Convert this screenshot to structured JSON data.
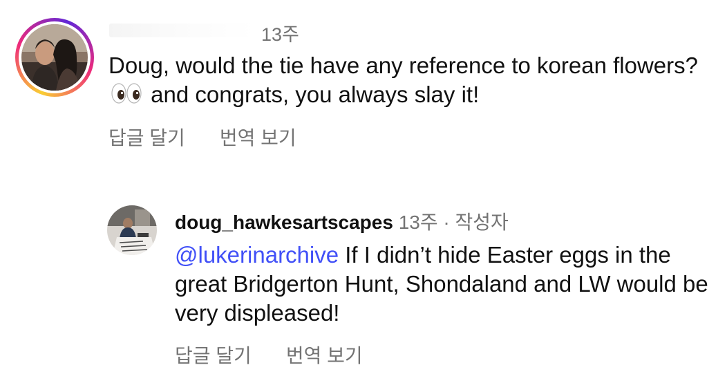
{
  "comment": {
    "time": "13주",
    "text_before_emoji": "Doug, would the tie have any reference to korean flowers?",
    "emoji": "eyes-emoji",
    "text_after_emoji": "and congrats, you always slay it!",
    "reply_label": "답글 달기",
    "translate_label": "번역 보기",
    "story_ring": true
  },
  "reply": {
    "username": "doug_hawkesartscapes",
    "time": "13주",
    "separator": "·",
    "author_badge": "작성자",
    "mention": "@lukerinarchive",
    "text": "If I didn’t hide Easter eggs in the great Bridgerton Hunt, Shondaland and LW would be very displeased!",
    "reply_label": "답글 달기",
    "translate_label": "번역 보기"
  },
  "colors": {
    "text": "#111111",
    "secondary": "#737373",
    "mention": "#4150f7"
  }
}
